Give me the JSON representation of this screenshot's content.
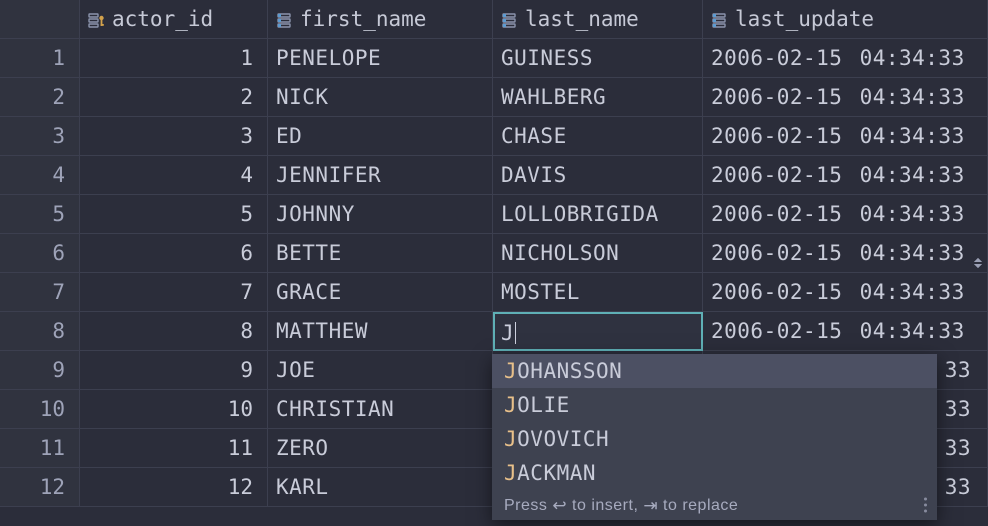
{
  "columns": [
    {
      "name": "actor_id",
      "kind": "pk"
    },
    {
      "name": "first_name",
      "kind": "col"
    },
    {
      "name": "last_name",
      "kind": "col"
    },
    {
      "name": "last_update",
      "kind": "col"
    }
  ],
  "rows": [
    {
      "n": 1,
      "actor_id": 1,
      "first_name": "PENELOPE",
      "last_name": "GUINESS",
      "last_update": "2006-02-15 04:34:33"
    },
    {
      "n": 2,
      "actor_id": 2,
      "first_name": "NICK",
      "last_name": "WAHLBERG",
      "last_update": "2006-02-15 04:34:33"
    },
    {
      "n": 3,
      "actor_id": 3,
      "first_name": "ED",
      "last_name": "CHASE",
      "last_update": "2006-02-15 04:34:33"
    },
    {
      "n": 4,
      "actor_id": 4,
      "first_name": "JENNIFER",
      "last_name": "DAVIS",
      "last_update": "2006-02-15 04:34:33"
    },
    {
      "n": 5,
      "actor_id": 5,
      "first_name": "JOHNNY",
      "last_name": "LOLLOBRIGIDA",
      "last_update": "2006-02-15 04:34:33"
    },
    {
      "n": 6,
      "actor_id": 6,
      "first_name": "BETTE",
      "last_name": "NICHOLSON",
      "last_update": "2006-02-15 04:34:33"
    },
    {
      "n": 7,
      "actor_id": 7,
      "first_name": "GRACE",
      "last_name": "MOSTEL",
      "last_update": "2006-02-15 04:34:33"
    },
    {
      "n": 8,
      "actor_id": 8,
      "first_name": "MATTHEW",
      "last_name": "J",
      "last_update": "2006-02-15 04:34:33",
      "editing_col": "last_name"
    },
    {
      "n": 9,
      "actor_id": 9,
      "first_name": "JOE",
      "last_name": "",
      "last_update": "33"
    },
    {
      "n": 10,
      "actor_id": 10,
      "first_name": "CHRISTIAN",
      "last_name": "",
      "last_update": "33"
    },
    {
      "n": 11,
      "actor_id": 11,
      "first_name": "ZERO",
      "last_name": "",
      "last_update": "33"
    },
    {
      "n": 12,
      "actor_id": 12,
      "first_name": "KARL",
      "last_name": "",
      "last_update": "33"
    }
  ],
  "editor": {
    "row_index": 7,
    "value": "J"
  },
  "autocomplete": {
    "items": [
      {
        "prefix": "J",
        "rest": "OHANSSON",
        "selected": true
      },
      {
        "prefix": "J",
        "rest": "OLIE"
      },
      {
        "prefix": "J",
        "rest": "OVOVICH"
      },
      {
        "prefix": "J",
        "rest": "ACKMAN"
      }
    ],
    "hint_pre": "Press ",
    "hint_key1": "↩",
    "hint_mid": " to insert, ",
    "hint_key2": "⇥",
    "hint_post": " to replace"
  }
}
